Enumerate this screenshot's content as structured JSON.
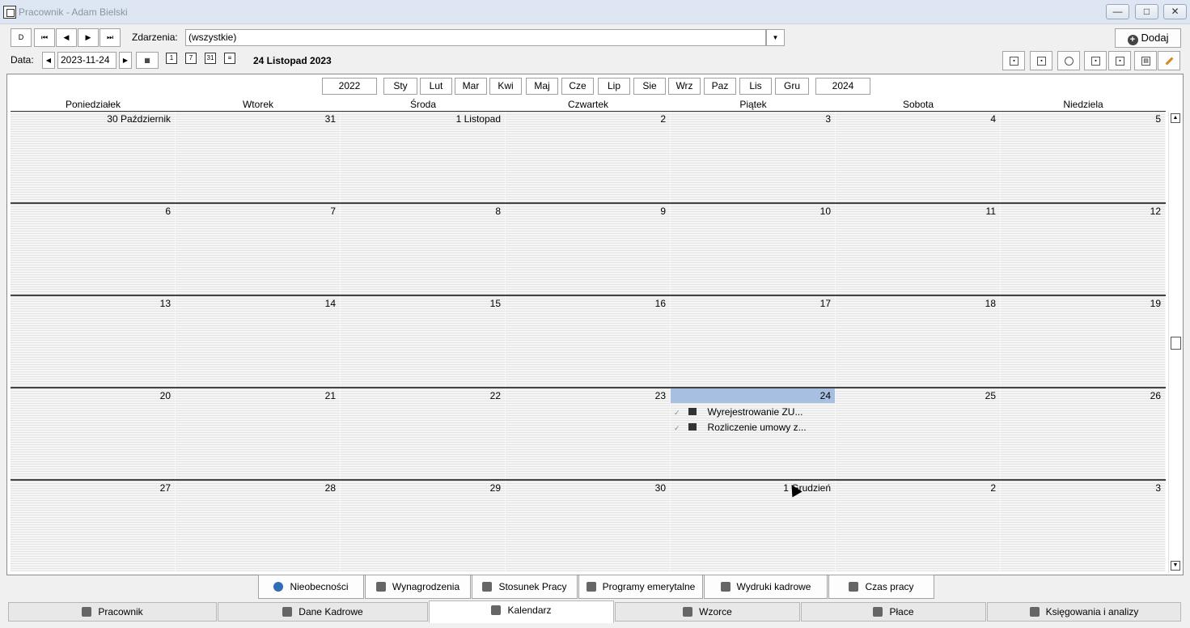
{
  "window": {
    "title": "Pracownik - Adam Bielski"
  },
  "toolbar": {
    "events_label": "Zdarzenia:",
    "events_value": "(wszystkie)",
    "add_label": "Dodaj",
    "date_label": "Data:",
    "date_value": "2023-11-24",
    "current_date": "24 Listopad 2023",
    "nav_first": "D"
  },
  "calendar": {
    "prev_year": "2022",
    "next_year": "2024",
    "months": [
      "Sty",
      "Lut",
      "Mar",
      "Kwi",
      "Maj",
      "Cze",
      "Lip",
      "Sie",
      "Wrz",
      "Paz",
      "Lis",
      "Gru"
    ],
    "day_names": [
      "Poniedziałek",
      "Wtorek",
      "Środa",
      "Czwartek",
      "Piątek",
      "Sobota",
      "Niedziela"
    ],
    "weeks": [
      [
        "30 Październik",
        "31",
        "1 Listopad",
        "2",
        "3",
        "4",
        "5"
      ],
      [
        "6",
        "7",
        "8",
        "9",
        "10",
        "11",
        "12"
      ],
      [
        "13",
        "14",
        "15",
        "16",
        "17",
        "18",
        "19"
      ],
      [
        "20",
        "21",
        "22",
        "23",
        "24",
        "25",
        "26"
      ],
      [
        "27",
        "28",
        "29",
        "30",
        "1 Grudzień",
        "2",
        "3"
      ]
    ],
    "today": "24",
    "events": [
      {
        "label": "Wyrejestrowanie ZU..."
      },
      {
        "label": "Rozliczenie umowy z..."
      }
    ]
  },
  "bottom_tabs": [
    "Nieobecności",
    "Wynagrodzenia",
    "Stosunek Pracy",
    "Programy emerytalne",
    "Wydruki kadrowe",
    "Czas pracy"
  ],
  "main_tabs": [
    "Pracownik",
    "Dane Kadrowe",
    "Kalendarz",
    "Wzorce",
    "Płace",
    "Księgowania i analizy"
  ],
  "active_main_tab": "Kalendarz",
  "colors": {
    "today_highlight": "#a7bfe0",
    "title_bar": "#dde6f2"
  }
}
